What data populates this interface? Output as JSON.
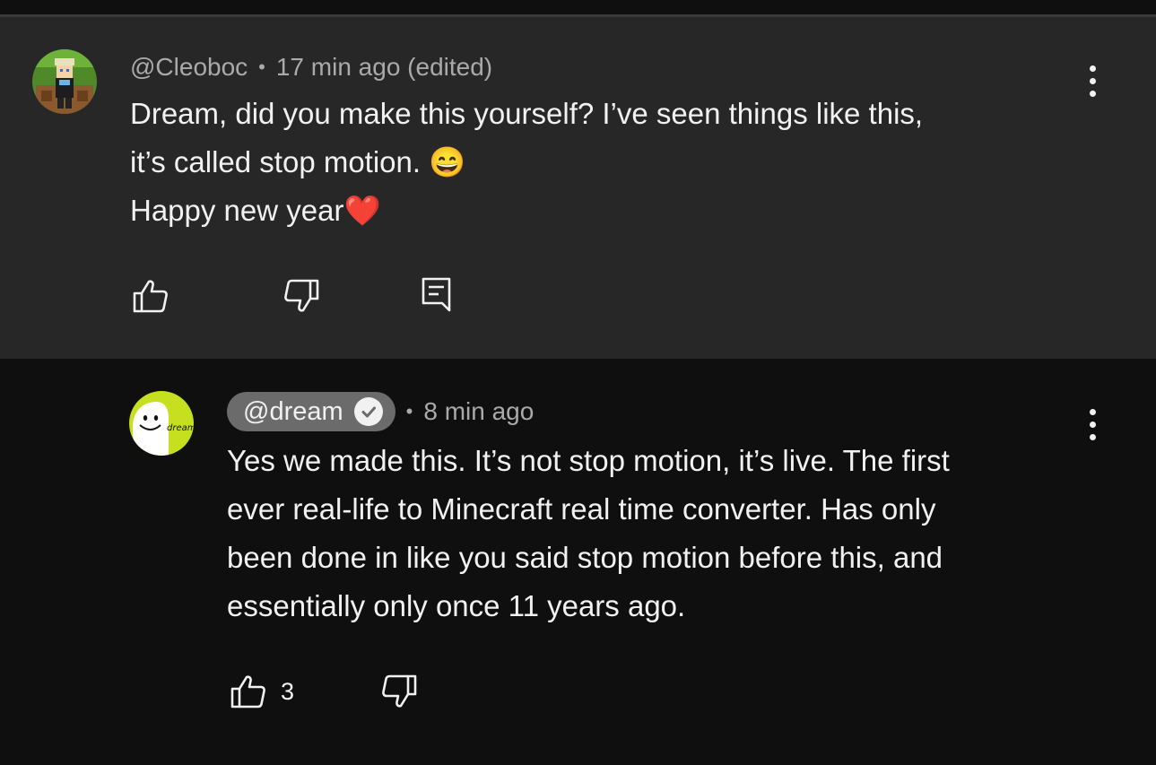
{
  "comment": {
    "author": "@Cleoboc",
    "time": "17 min ago (edited)",
    "lines": [
      "Dream, did you make this yourself? I’ve seen things like this,",
      "it’s called stop motion. 😄",
      "Happy new year❤️"
    ],
    "avatar_icon": "minecraft-skin-avatar"
  },
  "reply": {
    "author": "@dream",
    "verified_icon": "verified-check-icon",
    "time": "8 min ago",
    "lines": [
      "Yes we made this. It’s not stop motion, it’s live. The first",
      "ever real-life to Minecraft real time converter. Has only",
      "been done in like you said stop motion before this, and",
      "essentially only once 11 years ago."
    ],
    "likes": "3",
    "avatar_text": "dream",
    "avatar_color": "#c6e01f"
  },
  "separator": "•"
}
